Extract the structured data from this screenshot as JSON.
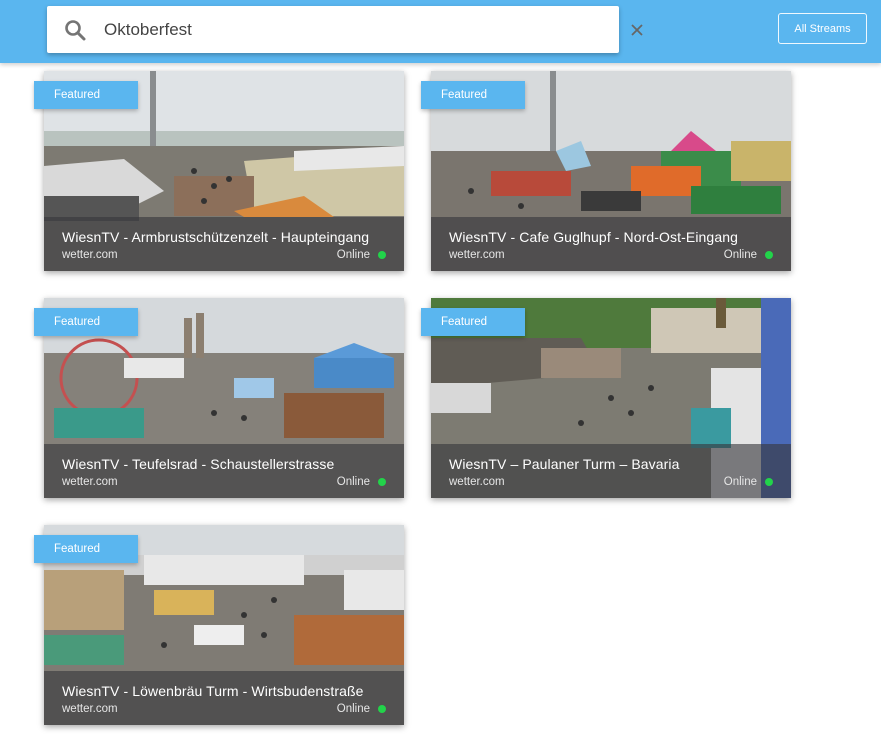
{
  "search": {
    "value": "Oktoberfest",
    "placeholder": ""
  },
  "header": {
    "all_streams_label": "All Streams"
  },
  "icons": {
    "search": "search-icon",
    "clear": "close-icon",
    "status": "online-dot"
  },
  "colors": {
    "bar": "#5ab6ef",
    "badge": "#5ab6ef",
    "online": "#22d34a"
  },
  "streams": [
    {
      "badge": "Featured",
      "title": "WiesnTV - Armbrustschützenzelt - Haupteingang",
      "source": "wetter.com",
      "status": "Online"
    },
    {
      "badge": "Featured",
      "title": "WiesnTV - Cafe Guglhupf - Nord-Ost-Eingang",
      "source": "wetter.com",
      "status": "Online"
    },
    {
      "badge": "Featured",
      "title": "WiesnTV - Teufelsrad - Schaustellerstrasse",
      "source": "wetter.com",
      "status": "Online"
    },
    {
      "badge": "Featured",
      "title": "WiesnTV – Paulaner Turm – Bavaria",
      "source": "wetter.com",
      "status": "Online"
    },
    {
      "badge": "Featured",
      "title": "WiesnTV - Löwenbräu Turm - Wirtsbudenstraße",
      "source": "wetter.com",
      "status": "Online"
    }
  ]
}
